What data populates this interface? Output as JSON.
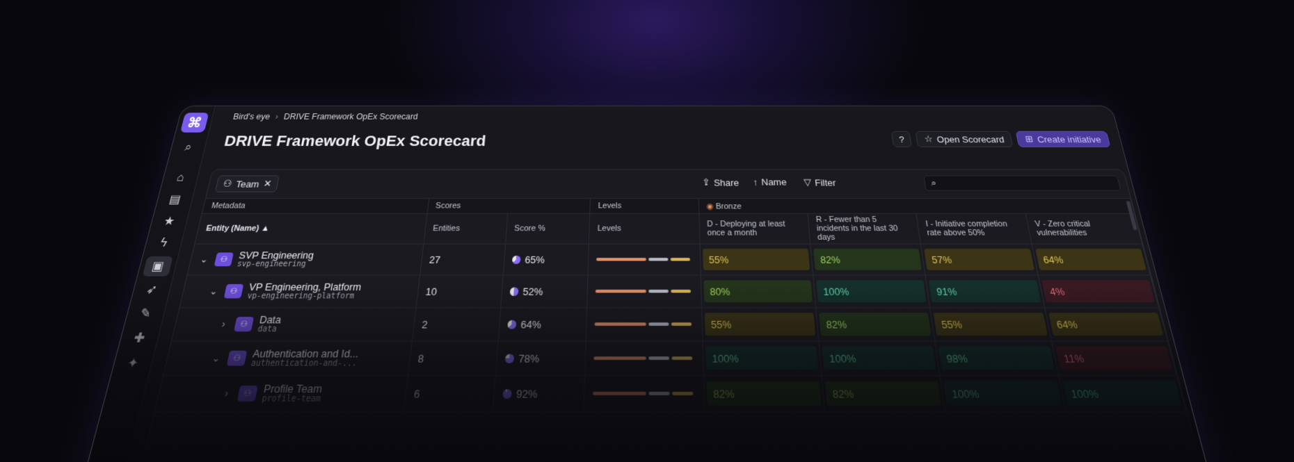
{
  "breadcrumb": {
    "parent": "Bird's eye",
    "current": "DRIVE Framework OpEx Scorecard"
  },
  "title": "DRIVE Framework OpEx Scorecard",
  "actions": {
    "open_scorecard": "Open Scorecard",
    "create_initiative": "Create initiative"
  },
  "toolbar": {
    "chip": "Team",
    "share": "Share",
    "sort": "Name",
    "filter": "Filter"
  },
  "groups": {
    "metadata": "Metadata",
    "scores": "Scores",
    "levels": "Levels",
    "bronze": "Bronze"
  },
  "columns": {
    "entity": "Entity (Name)",
    "entities": "Entities",
    "score": "Score %",
    "levels": "Levels",
    "d": "D - Deploying at least once a month",
    "r": "R - Fewer than 5 incidents in the last 30 days",
    "i": "I - Initiative completion rate above 50%",
    "v": "V - Zero critical vulnerabilities"
  },
  "rows": [
    {
      "name": "SVP Engineering",
      "slug": "svp-engineering",
      "entities": "27",
      "score": "65%",
      "score_frac": 0.65,
      "indent": 0,
      "expanded": true,
      "cells": [
        "55%",
        "82%",
        "57%",
        "64%"
      ],
      "cell_colors": [
        "yellow",
        "green",
        "yellow",
        "yellow"
      ]
    },
    {
      "name": "VP Engineering, Platform",
      "slug": "vp-engineering-platform",
      "entities": "10",
      "score": "52%",
      "score_frac": 0.52,
      "indent": 1,
      "expanded": true,
      "cells": [
        "80%",
        "100%",
        "91%",
        "4%"
      ],
      "cell_colors": [
        "green",
        "teal",
        "teal",
        "red"
      ]
    },
    {
      "name": "Data",
      "slug": "data",
      "entities": "2",
      "score": "64%",
      "score_frac": 0.64,
      "indent": 2,
      "expanded": false,
      "cells": [
        "55%",
        "82%",
        "55%",
        "64%"
      ],
      "cell_colors": [
        "yellow",
        "green",
        "yellow",
        "yellow"
      ]
    },
    {
      "name": "Authentication and Id...",
      "slug": "authentication-and-...",
      "entities": "8",
      "score": "78%",
      "score_frac": 0.78,
      "indent": 2,
      "expanded": true,
      "cells": [
        "100%",
        "100%",
        "98%",
        "11%"
      ],
      "cell_colors": [
        "teal",
        "teal",
        "teal",
        "red"
      ]
    },
    {
      "name": "Profile Team",
      "slug": "profile-team",
      "entities": "6",
      "score": "92%",
      "score_frac": 0.92,
      "indent": 3,
      "expanded": false,
      "cells": [
        "82%",
        "82%",
        "100%",
        "100%"
      ],
      "cell_colors": [
        "green",
        "green",
        "teal",
        "teal"
      ]
    }
  ]
}
